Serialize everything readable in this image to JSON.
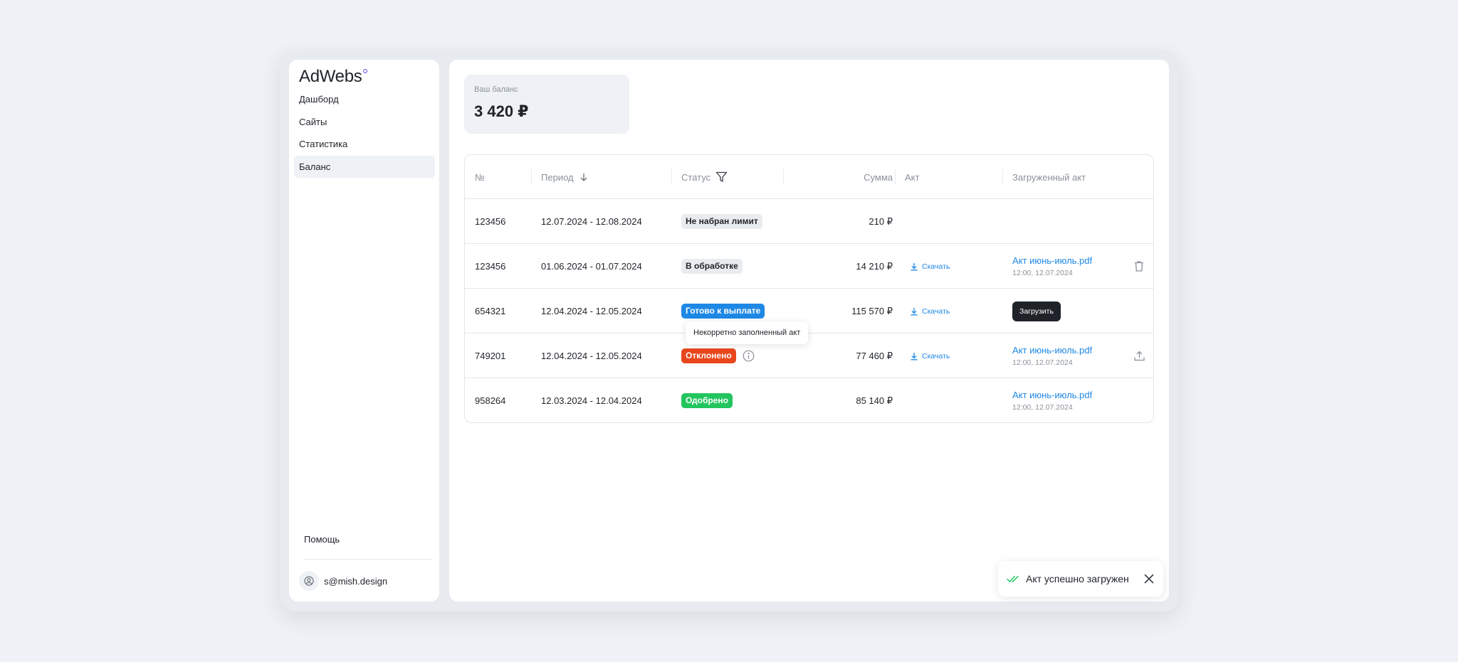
{
  "app": {
    "logo": "AdWebs",
    "brand_color": "#6b3df0"
  },
  "sidebar": {
    "items": [
      {
        "label": "Дашборд",
        "active": false
      },
      {
        "label": "Сайты",
        "active": false
      },
      {
        "label": "Статистика",
        "active": false
      },
      {
        "label": "Баланс",
        "active": true
      }
    ],
    "help_label": "Помощь",
    "user_email": "s@mish.design",
    "user_icon": "user-circle-icon"
  },
  "balance": {
    "label": "Ваш баланс",
    "value": "3 420 ₽"
  },
  "table": {
    "columns": {
      "number": "№",
      "period": "Период",
      "status": "Статус",
      "sum": "Сумма",
      "act": "Акт",
      "uploaded_act": "Загруженный акт"
    },
    "rows": [
      {
        "number": "123456",
        "period": "12.07.2024 - 12.08.2024",
        "status": "Не набран лимит",
        "status_color": "#e9ecef",
        "sum": "210 ₽"
      },
      {
        "number": "123456",
        "period": "01.06.2024 - 01.07.2024",
        "status": "В обработке",
        "status_color": "#e9ecef",
        "sum": "14 210 ₽",
        "act": "Скачать",
        "file_name": "Акт июнь-июль.pdf",
        "file_time": "12:00, 12.07.2024",
        "row_icon": "trash-icon"
      },
      {
        "number": "654321",
        "period": "12.04.2024 - 12.05.2024",
        "status": "Готово к выплате",
        "status_color": "#1e88e5",
        "sum": "115 570 ₽",
        "act": "Скачать",
        "upload_label": "Загрузить"
      },
      {
        "number": "749201",
        "period": "12.04.2024 - 12.05.2024",
        "status": "Отклонено",
        "status_color": "#e8471d",
        "sum": "77 460 ₽",
        "act": "Скачать",
        "file_name": "Акт июнь-июль.pdf",
        "file_time": "12:00, 12.07.2024",
        "row_icon": "upload-icon"
      },
      {
        "number": "958264",
        "period": "12.03.2024 - 12.04.2024",
        "status": "Одобрено",
        "status_color": "#22c55e",
        "sum": "85 140 ₽",
        "file_name": "Акт июнь-июль.pdf",
        "file_time": "12:00, 12.07.2024"
      }
    ]
  },
  "tooltip": {
    "text": "Некорретно заполненный акт"
  },
  "toast": {
    "text": "Акт успешно загружен",
    "icon": "double-check-icon",
    "icon_color": "#22c55e"
  }
}
